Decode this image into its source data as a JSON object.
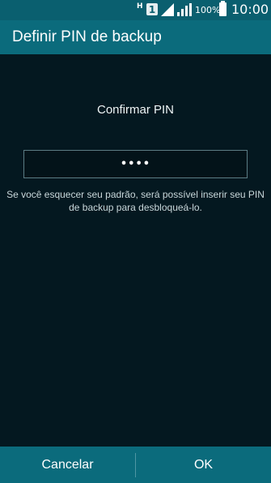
{
  "status_bar": {
    "network_type": "H",
    "sim_slot": "1",
    "battery_percent": "100%",
    "time": "10:00",
    "icons": [
      "sim-1-icon",
      "signal-icon",
      "signal-icon",
      "battery-icon"
    ]
  },
  "header": {
    "title": "Definir PIN de backup"
  },
  "main": {
    "prompt": "Confirmar PIN",
    "pin_masked": "••••",
    "hint": "Se você esquecer seu padrão, será possível inserir seu PIN de backup para desbloqueá-lo."
  },
  "bottom": {
    "cancel_label": "Cancelar",
    "ok_label": "OK"
  },
  "colors": {
    "background": "#041820",
    "status_bar": "#0a5f6f",
    "action_bar": "#0b6b7c",
    "text": "#ffffff"
  }
}
